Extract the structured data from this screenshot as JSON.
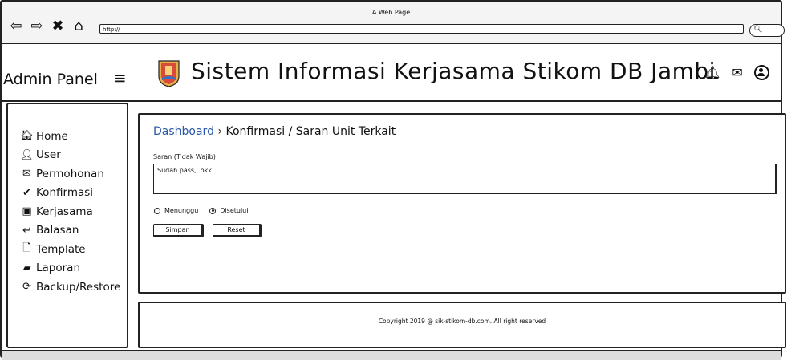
{
  "browser": {
    "title": "A Web Page",
    "url": "http://",
    "nav_icons": [
      "back-icon",
      "forward-icon",
      "close-icon",
      "home-icon"
    ],
    "search_icon": "search-icon"
  },
  "header": {
    "admin_label": "Admin Panel",
    "menu_icon": "hamburger-icon",
    "site_title": "Sistem Informasi Kerjasama Stikom DB Jambi",
    "icons": [
      "bell-icon",
      "envelope-icon",
      "user-circle-icon"
    ]
  },
  "sidebar": {
    "items": [
      {
        "label": "Home",
        "icon": "home-icon"
      },
      {
        "label": "User",
        "icon": "user-icon"
      },
      {
        "label": "Permohonan",
        "icon": "envelope-icon"
      },
      {
        "label": "Konfirmasi",
        "icon": "check-icon"
      },
      {
        "label": "Kerjasama",
        "icon": "handshake-icon"
      },
      {
        "label": "Balasan",
        "icon": "reply-icon"
      },
      {
        "label": "Template",
        "icon": "word-file-icon"
      },
      {
        "label": "Laporan",
        "icon": "book-icon"
      },
      {
        "label": "Backup/Restore",
        "icon": "refresh-icon"
      }
    ]
  },
  "main": {
    "breadcrumb_link": "Dashboard",
    "breadcrumb_sep": "›",
    "breadcrumb_current": "Konfirmasi / Saran Unit Terkait",
    "saran_label": "Saran (Tidak Wajib)",
    "saran_value": "Sudah pass,, okk",
    "radio_options": [
      {
        "label": "Menunggu",
        "checked": false
      },
      {
        "label": "Disetujui",
        "checked": true
      }
    ],
    "buttons": {
      "save": "Simpan",
      "reset": "Reset"
    }
  },
  "footer": {
    "copyright": "Copyright 2019 @ sik-stikom-db.com. All right reserved"
  },
  "colors": {
    "link": "#2a57a8",
    "border": "#222222"
  }
}
